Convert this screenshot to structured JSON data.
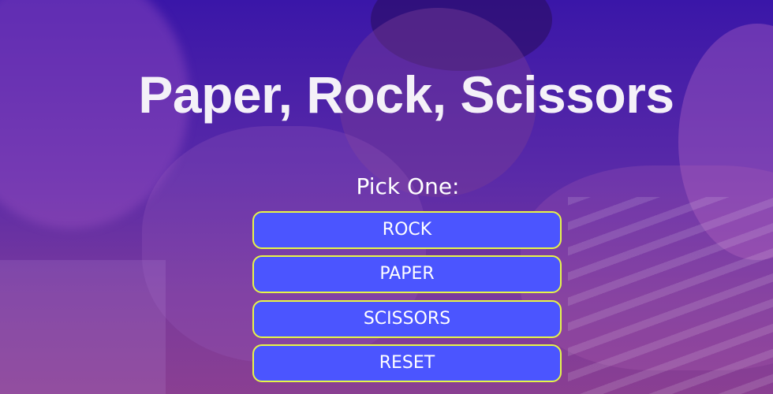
{
  "page": {
    "title": "Paper, Rock, Scissors",
    "prompt": "Pick One:"
  },
  "buttons": {
    "rock": "ROCK",
    "paper": "PAPER",
    "scissors": "SCISSORS",
    "reset": "RESET"
  },
  "colors": {
    "overlay_top": "#3a16a8",
    "overlay_bottom": "#8a3f92",
    "button_fill": "#4b55ff",
    "button_border": "#e7f547",
    "text": "#ffffff"
  }
}
